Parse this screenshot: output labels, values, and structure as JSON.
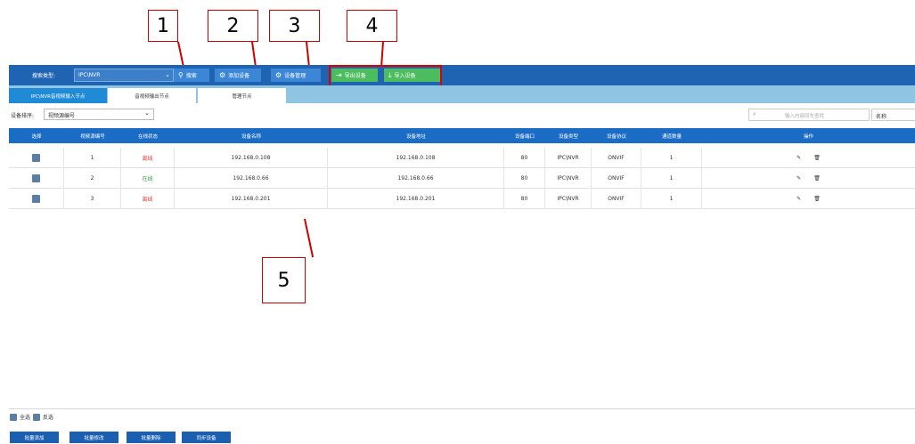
{
  "callouts": [
    "1",
    "2",
    "3",
    "4",
    "5"
  ],
  "toolbar": {
    "search_type_label": "搜索类型:",
    "search_type_value": "IPC\\NVR",
    "search_btn": "搜索",
    "add_btn": "添加设备",
    "manage_btn": "设备管理",
    "export_btn": "导出设备",
    "import_btn": "导入设备"
  },
  "tabs": [
    "IPC\\NVR音视频输入节点",
    "音视频输出节点",
    "管理节点"
  ],
  "filter": {
    "sort_label": "设备排序:",
    "sort_value": "视频源编号",
    "search_placeholder": "输入内容回车查找",
    "field_value": "名称"
  },
  "table": {
    "columns": [
      "选择",
      "视频源编号",
      "在线状态",
      "设备名称",
      "设备地址",
      "设备端口",
      "设备类型",
      "设备协议",
      "通道数量",
      "操作"
    ],
    "rows": [
      {
        "num": "1",
        "status": "离线",
        "status_type": "offline",
        "name": "192.168.0.108",
        "address": "192.168.0.108",
        "port": "80",
        "type": "IPC\\NVR",
        "protocol": "ONVIF",
        "channels": "1"
      },
      {
        "num": "2",
        "status": "在线",
        "status_type": "online",
        "name": "192.168.0.66",
        "address": "192.168.0.66",
        "port": "80",
        "type": "IPC\\NVR",
        "protocol": "ONVIF",
        "channels": "1"
      },
      {
        "num": "3",
        "status": "离线",
        "status_type": "offline",
        "name": "192.168.0.201",
        "address": "192.168.0.201",
        "port": "80",
        "type": "IPC\\NVR",
        "protocol": "ONVIF",
        "channels": "1"
      }
    ]
  },
  "footer": {
    "select_all": "全选",
    "invert": "反选",
    "batch_add": "批量添加",
    "batch_edit": "批量修改",
    "batch_delete": "批量删除",
    "sync_device": "同步设备"
  },
  "colors": {
    "toolbar": "#1f63b3",
    "tabbar": "#8fc4e3",
    "header": "#1a6cc4",
    "offline": "#e03a3a",
    "online": "#2e9b3c",
    "annotation": "#d10000"
  }
}
